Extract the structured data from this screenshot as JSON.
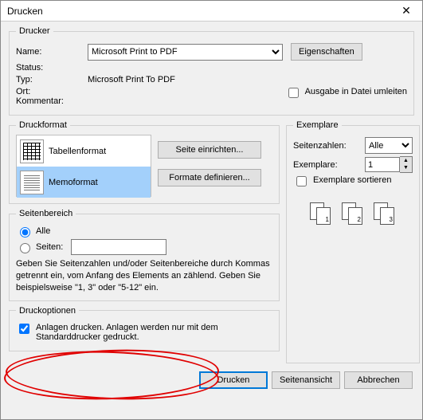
{
  "title": "Drucken",
  "printer": {
    "legend": "Drucker",
    "name_label": "Name:",
    "name_value": "Microsoft Print to PDF",
    "properties_btn": "Eigenschaften",
    "status_label": "Status:",
    "status_value": "",
    "type_label": "Typ:",
    "type_value": "Microsoft Print To PDF",
    "location_label": "Ort:",
    "location_value": "",
    "comment_label": "Kommentar:",
    "comment_value": "",
    "redirect_to_file": "Ausgabe in Datei umleiten"
  },
  "format": {
    "legend": "Druckformat",
    "items": [
      "Tabellenformat",
      "Memoformat"
    ],
    "selected_index": 1,
    "page_setup_btn": "Seite einrichten...",
    "define_formats_btn": "Formate definieren..."
  },
  "copies": {
    "legend": "Exemplare",
    "pages_label": "Seitenzahlen:",
    "pages_value": "Alle",
    "copies_label": "Exemplare:",
    "copies_value": "1",
    "collate_label": "Exemplare sortieren"
  },
  "page_range": {
    "legend": "Seitenbereich",
    "all_label": "Alle",
    "pages_radio_label": "Seiten:",
    "pages_input": "",
    "hint": "Geben Sie Seitenzahlen und/oder Seitenbereiche durch Kommas getrennt ein, vom Anfang des Elements an zählend. Geben Sie beispielsweise \"1, 3\" oder \"5-12\" ein."
  },
  "options": {
    "legend": "Druckoptionen",
    "attach_label": "Anlagen drucken. Anlagen werden nur mit dem Standarddrucker gedruckt."
  },
  "footer": {
    "print_btn": "Drucken",
    "preview_btn": "Seitenansicht",
    "cancel_btn": "Abbrechen"
  }
}
